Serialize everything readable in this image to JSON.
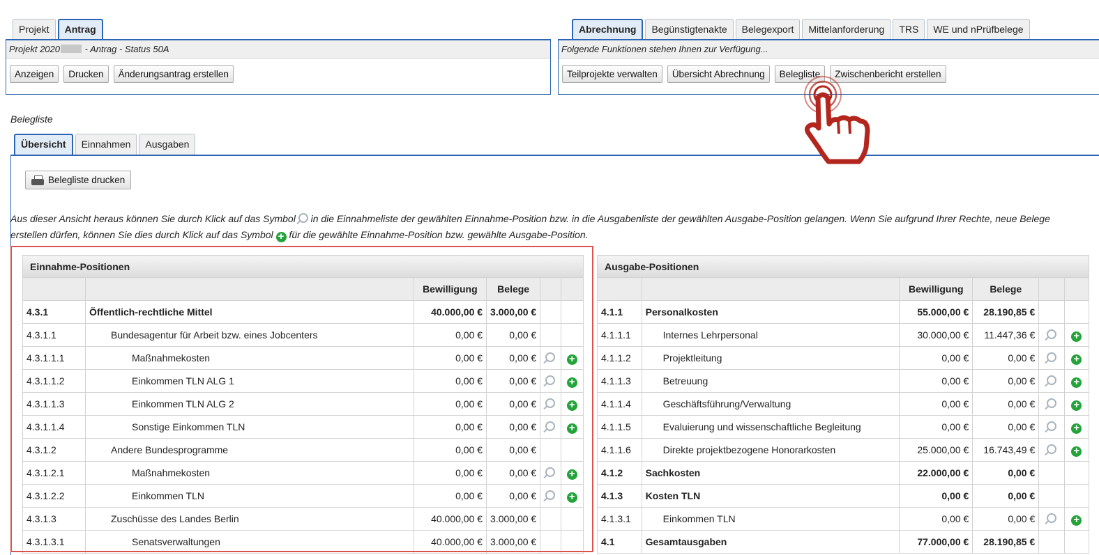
{
  "left_tabs": [
    {
      "label": "Projekt",
      "active": false
    },
    {
      "label": "Antrag",
      "active": true
    }
  ],
  "left_panel": {
    "title_start": "Projekt 2020",
    "title_end": " - Antrag - Status 50A",
    "buttons": [
      "Anzeigen",
      "Drucken",
      "Änderungsantrag erstellen"
    ]
  },
  "right_tabs": [
    {
      "label": "Abrechnung",
      "active": true
    },
    {
      "label": "Begünstigtenakte",
      "active": false
    },
    {
      "label": "Belegexport",
      "active": false
    },
    {
      "label": "Mittelanforderung",
      "active": false
    },
    {
      "label": "TRS",
      "active": false
    },
    {
      "label": "WE und nPrüfbelege",
      "active": false
    }
  ],
  "right_panel": {
    "title": "Folgende Funktionen stehen Ihnen zur Verfügung...",
    "buttons": [
      "Teilprojekte verwalten",
      "Übersicht Abrechnung",
      "Belegliste",
      "Zwischenbericht erstellen"
    ]
  },
  "section_title": "Belegliste",
  "sub_tabs": [
    {
      "label": "Übersicht",
      "active": true
    },
    {
      "label": "Einnahmen",
      "active": false
    },
    {
      "label": "Ausgaben",
      "active": false
    }
  ],
  "print_button": "Belegliste drucken",
  "info_text": {
    "part1": "Aus dieser Ansicht heraus können Sie durch Klick auf das Symbol ",
    "part2": " in die Einnahmeliste der gewählten Einnahme-Position bzw. in die Ausgabenliste der gewählten Ausgabe-Position gelangen. Wenn Sie aufgrund Ihrer Rechte, neue Belege erstellen dürfen, können Sie dies durch Klick auf das Symbol ",
    "part3": " für die gewählte Einnahme-Position bzw. gewählte Ausgabe-Position."
  },
  "plus_glyph": "+",
  "einnahmen": {
    "title": "Einnahme-Positionen",
    "col_bewilligung": "Bewilligung",
    "col_belege": "Belege",
    "rows": [
      {
        "code": "4.3.1",
        "name": "Öffentlich-rechtliche Mittel",
        "bew": "40.000,00 €",
        "bel": "3.000,00 €",
        "bold": true,
        "level": 0,
        "icons": false
      },
      {
        "code": "4.3.1.1",
        "name": "Bundesagentur für Arbeit bzw. eines Jobcenters",
        "bew": "0,00 €",
        "bel": "0,00 €",
        "bold": false,
        "level": 1,
        "icons": false
      },
      {
        "code": "4.3.1.1.1",
        "name": "Maßnahmekosten",
        "bew": "0,00 €",
        "bel": "0,00 €",
        "bold": false,
        "level": 2,
        "icons": true
      },
      {
        "code": "4.3.1.1.2",
        "name": "Einkommen TLN ALG 1",
        "bew": "0,00 €",
        "bel": "0,00 €",
        "bold": false,
        "level": 2,
        "icons": true
      },
      {
        "code": "4.3.1.1.3",
        "name": "Einkommen TLN ALG 2",
        "bew": "0,00 €",
        "bel": "0,00 €",
        "bold": false,
        "level": 2,
        "icons": true
      },
      {
        "code": "4.3.1.1.4",
        "name": "Sonstige Einkommen TLN",
        "bew": "0,00 €",
        "bel": "0,00 €",
        "bold": false,
        "level": 2,
        "icons": true
      },
      {
        "code": "4.3.1.2",
        "name": "Andere Bundesprogramme",
        "bew": "0,00 €",
        "bel": "0,00 €",
        "bold": false,
        "level": 1,
        "icons": false
      },
      {
        "code": "4.3.1.2.1",
        "name": "Maßnahmekosten",
        "bew": "0,00 €",
        "bel": "0,00 €",
        "bold": false,
        "level": 2,
        "icons": true
      },
      {
        "code": "4.3.1.2.2",
        "name": "Einkommen TLN",
        "bew": "0,00 €",
        "bel": "0,00 €",
        "bold": false,
        "level": 2,
        "icons": true
      },
      {
        "code": "4.3.1.3",
        "name": "Zuschüsse des Landes Berlin",
        "bew": "40.000,00 €",
        "bel": "3.000,00 €",
        "bold": false,
        "level": 1,
        "icons": false
      },
      {
        "code": "4.3.1.3.1",
        "name": "Senatsverwaltungen",
        "bew": "40.000,00 €",
        "bel": "3.000,00 €",
        "bold": false,
        "level": 2,
        "icons": false
      }
    ]
  },
  "ausgaben": {
    "title": "Ausgabe-Positionen",
    "col_bewilligung": "Bewilligung",
    "col_belege": "Belege",
    "rows": [
      {
        "code": "4.1.1",
        "name": "Personalkosten",
        "bew": "55.000,00 €",
        "bel": "28.190,85 €",
        "bold": true,
        "level": 0,
        "icons": false
      },
      {
        "code": "4.1.1.1",
        "name": "Internes Lehrpersonal",
        "bew": "30.000,00 €",
        "bel": "11.447,36 €",
        "bold": false,
        "level": 1,
        "icons": true
      },
      {
        "code": "4.1.1.2",
        "name": "Projektleitung",
        "bew": "0,00 €",
        "bel": "0,00 €",
        "bold": false,
        "level": 1,
        "icons": true
      },
      {
        "code": "4.1.1.3",
        "name": "Betreuung",
        "bew": "0,00 €",
        "bel": "0,00 €",
        "bold": false,
        "level": 1,
        "icons": true
      },
      {
        "code": "4.1.1.4",
        "name": "Geschäftsführung/Verwaltung",
        "bew": "0,00 €",
        "bel": "0,00 €",
        "bold": false,
        "level": 1,
        "icons": true
      },
      {
        "code": "4.1.1.5",
        "name": "Evaluierung und wissenschaftliche Begleitung",
        "bew": "0,00 €",
        "bel": "0,00 €",
        "bold": false,
        "level": 1,
        "icons": true
      },
      {
        "code": "4.1.1.6",
        "name": "Direkte projektbezogene Honorarkosten",
        "bew": "25.000,00 €",
        "bel": "16.743,49 €",
        "bold": false,
        "level": 1,
        "icons": true
      },
      {
        "code": "4.1.2",
        "name": "Sachkosten",
        "bew": "22.000,00 €",
        "bel": "0,00 €",
        "bold": true,
        "level": 0,
        "icons": false
      },
      {
        "code": "4.1.3",
        "name": "Kosten TLN",
        "bew": "0,00 €",
        "bel": "0,00 €",
        "bold": true,
        "level": 0,
        "icons": false
      },
      {
        "code": "4.1.3.1",
        "name": "Einkommen TLN",
        "bew": "0,00 €",
        "bel": "0,00 €",
        "bold": false,
        "level": 1,
        "icons": true
      },
      {
        "code": "4.1",
        "name": "Gesamtausgaben",
        "bew": "77.000,00 €",
        "bel": "28.190,85 €",
        "bold": true,
        "level": 0,
        "icons": false
      }
    ]
  },
  "colors": {
    "accent": "#2d64b3",
    "highlight": "#d9534f",
    "add_green": "#23a33a",
    "hand": "#b3261e"
  },
  "icons": {
    "view": "magnifier-icon",
    "add": "plus-circle-icon",
    "pointer": "pointing-hand-icon",
    "print": "printer-icon"
  }
}
